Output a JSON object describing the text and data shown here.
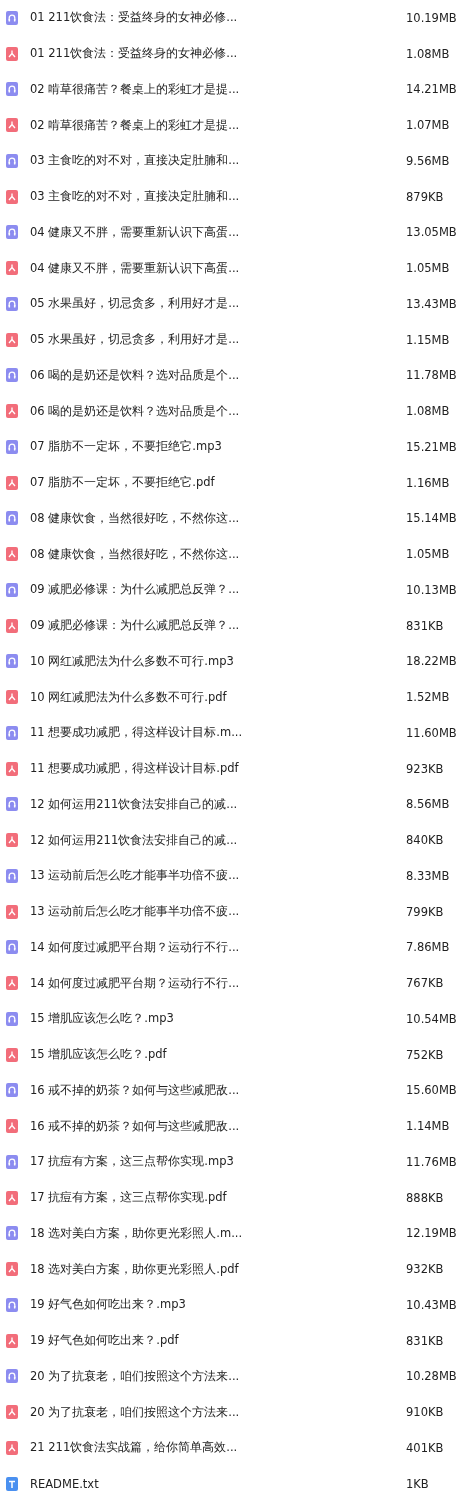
{
  "files": [
    {
      "kind": "audio",
      "name": "01 211饮食法：受益终身的女神必修...",
      "size": "10.19MB"
    },
    {
      "kind": "pdf",
      "name": "01 211饮食法：受益终身的女神必修...",
      "size": "1.08MB"
    },
    {
      "kind": "audio",
      "name": "02 啃草很痛苦？餐桌上的彩虹才是提...",
      "size": "14.21MB"
    },
    {
      "kind": "pdf",
      "name": "02 啃草很痛苦？餐桌上的彩虹才是提...",
      "size": "1.07MB"
    },
    {
      "kind": "audio",
      "name": "03 主食吃的对不对，直接决定肚腩和...",
      "size": "9.56MB"
    },
    {
      "kind": "pdf",
      "name": "03 主食吃的对不对，直接决定肚腩和...",
      "size": "879KB"
    },
    {
      "kind": "audio",
      "name": "04 健康又不胖，需要重新认识下高蛋...",
      "size": "13.05MB"
    },
    {
      "kind": "pdf",
      "name": "04 健康又不胖，需要重新认识下高蛋...",
      "size": "1.05MB"
    },
    {
      "kind": "audio",
      "name": "05 水果虽好，切忌贪多，利用好才是...",
      "size": "13.43MB"
    },
    {
      "kind": "pdf",
      "name": "05 水果虽好，切忌贪多，利用好才是...",
      "size": "1.15MB"
    },
    {
      "kind": "audio",
      "name": "06 喝的是奶还是饮料？选对品质是个...",
      "size": "11.78MB"
    },
    {
      "kind": "pdf",
      "name": "06 喝的是奶还是饮料？选对品质是个...",
      "size": "1.08MB"
    },
    {
      "kind": "audio",
      "name": "07 脂肪不一定坏，不要拒绝它.mp3",
      "size": "15.21MB"
    },
    {
      "kind": "pdf",
      "name": "07 脂肪不一定坏，不要拒绝它.pdf",
      "size": "1.16MB"
    },
    {
      "kind": "audio",
      "name": "08 健康饮食，当然很好吃，不然你这...",
      "size": "15.14MB"
    },
    {
      "kind": "pdf",
      "name": "08 健康饮食，当然很好吃，不然你这...",
      "size": "1.05MB"
    },
    {
      "kind": "audio",
      "name": "09 减肥必修课：为什么减肥总反弹？...",
      "size": "10.13MB"
    },
    {
      "kind": "pdf",
      "name": "09 减肥必修课：为什么减肥总反弹？...",
      "size": "831KB"
    },
    {
      "kind": "audio",
      "name": "10 网红减肥法为什么多数不可行.mp3",
      "size": "18.22MB"
    },
    {
      "kind": "pdf",
      "name": "10 网红减肥法为什么多数不可行.pdf",
      "size": "1.52MB"
    },
    {
      "kind": "audio",
      "name": "11 想要成功减肥，得这样设计目标.m...",
      "size": "11.60MB"
    },
    {
      "kind": "pdf",
      "name": "11 想要成功减肥，得这样设计目标.pdf",
      "size": "923KB"
    },
    {
      "kind": "audio",
      "name": "12 如何运用211饮食法安排自己的减...",
      "size": "8.56MB"
    },
    {
      "kind": "pdf",
      "name": "12 如何运用211饮食法安排自己的减...",
      "size": "840KB"
    },
    {
      "kind": "audio",
      "name": "13 运动前后怎么吃才能事半功倍不疲...",
      "size": "8.33MB"
    },
    {
      "kind": "pdf",
      "name": "13 运动前后怎么吃才能事半功倍不疲...",
      "size": "799KB"
    },
    {
      "kind": "audio",
      "name": "14 如何度过减肥平台期？运动行不行...",
      "size": "7.86MB"
    },
    {
      "kind": "pdf",
      "name": "14 如何度过减肥平台期？运动行不行...",
      "size": "767KB"
    },
    {
      "kind": "audio",
      "name": "15 增肌应该怎么吃？.mp3",
      "size": "10.54MB"
    },
    {
      "kind": "pdf",
      "name": "15 增肌应该怎么吃？.pdf",
      "size": "752KB"
    },
    {
      "kind": "audio",
      "name": "16 戒不掉的奶茶？如何与这些减肥敌...",
      "size": "15.60MB"
    },
    {
      "kind": "pdf",
      "name": "16 戒不掉的奶茶？如何与这些减肥敌...",
      "size": "1.14MB"
    },
    {
      "kind": "audio",
      "name": "17 抗痘有方案，这三点帮你实现.mp3",
      "size": "11.76MB"
    },
    {
      "kind": "pdf",
      "name": "17 抗痘有方案，这三点帮你实现.pdf",
      "size": "888KB"
    },
    {
      "kind": "audio",
      "name": "18 选对美白方案，助你更光彩照人.m...",
      "size": "12.19MB"
    },
    {
      "kind": "pdf",
      "name": "18 选对美白方案，助你更光彩照人.pdf",
      "size": "932KB"
    },
    {
      "kind": "audio",
      "name": "19 好气色如何吃出来？.mp3",
      "size": "10.43MB"
    },
    {
      "kind": "pdf",
      "name": "19 好气色如何吃出来？.pdf",
      "size": "831KB"
    },
    {
      "kind": "audio",
      "name": "20 为了抗衰老，咱们按照这个方法来...",
      "size": "10.28MB"
    },
    {
      "kind": "pdf",
      "name": "20 为了抗衰老，咱们按照这个方法来...",
      "size": "910KB"
    },
    {
      "kind": "pdf",
      "name": "21 211饮食法实战篇，给你简单高效...",
      "size": "401KB"
    },
    {
      "kind": "txt",
      "name": "README.txt",
      "size": "1KB"
    }
  ]
}
